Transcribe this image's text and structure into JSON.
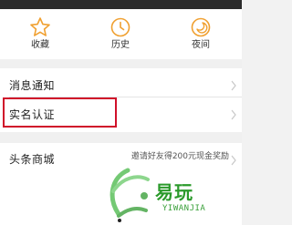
{
  "quick_actions": [
    {
      "label": "收藏",
      "icon": "star-icon"
    },
    {
      "label": "历史",
      "icon": "history-clock-icon"
    },
    {
      "label": "夜间",
      "icon": "night-mode-icon"
    }
  ],
  "menu": {
    "notifications": "消息通知",
    "real_name_auth": "实名认证",
    "mall": "头条商城",
    "mall_promo": "邀请好友得200元现金奖励"
  },
  "watermark": {
    "brand": "易玩",
    "site": "YIWANJIA"
  },
  "colors": {
    "icon_orange": "#f0a030",
    "highlight_red": "#d0102a",
    "watermark_green": "#2b9a2b"
  }
}
